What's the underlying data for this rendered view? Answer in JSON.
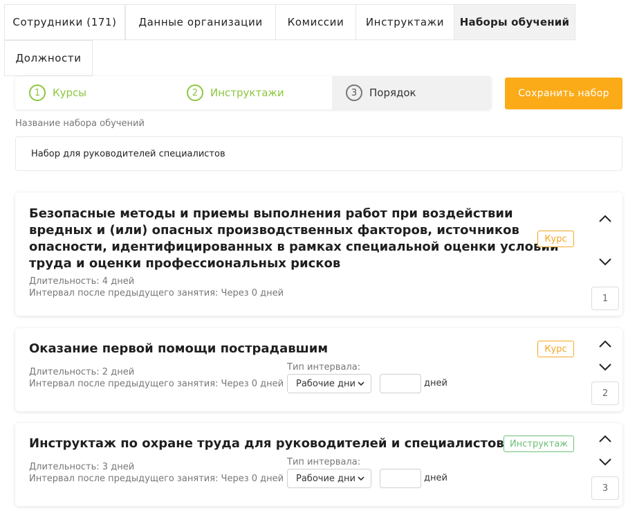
{
  "tabs": [
    {
      "label": "Сотрудники (171)",
      "active": false
    },
    {
      "label": "Данные организации",
      "active": false
    },
    {
      "label": "Комиссии",
      "active": false
    },
    {
      "label": "Инструктажи",
      "active": false
    },
    {
      "label": "Наборы обучений",
      "active": true
    },
    {
      "label": "Должности",
      "active": false
    }
  ],
  "stepper": [
    {
      "num": "1",
      "label": "Курсы",
      "state": "done"
    },
    {
      "num": "2",
      "label": "Инструктажи",
      "state": "done"
    },
    {
      "num": "3",
      "label": "Порядок",
      "state": "current"
    }
  ],
  "save_button": "Сохранить набор",
  "set_name": {
    "label": "Название набора обучений",
    "value": "Набор для руководителей специалистов"
  },
  "items": [
    {
      "title_lines": [
        "Безопасные методы и приемы выполнения работ при воздействии",
        "вредных и (или) опасных производственных факторов, источников",
        "опасности, идентифицированных в рамках специальной оценки условий",
        "труда и оценки профессиональных рисков"
      ],
      "badge": "Курс",
      "duration": "Длительность: 4 дней",
      "interval": "Интервал после предыдущего занятия: Через 0 дней",
      "order": "1"
    },
    {
      "title_lines": [
        "Оказание первой помощи пострадавшим"
      ],
      "badge": "Курс",
      "duration": "Длительность: 2 дней",
      "interval": "Интервал после предыдущего занятия: Через 0 дней",
      "interval_type_label": "Тип интервала:",
      "interval_type_value": "Рабочие дни",
      "interval_days_value": "",
      "days_unit": "дней",
      "order": "2"
    },
    {
      "title_lines": [
        "Инструктаж по охране труда для руководителей и специалистов"
      ],
      "badge": "Инструктаж",
      "duration": "Длительность: 3 дней",
      "interval": "Интервал после предыдущего занятия: Через 0 дней",
      "interval_type_label": "Тип интервала:",
      "interval_type_value": "Рабочие дни",
      "interval_days_value": "",
      "days_unit": "дней",
      "order": "3"
    }
  ],
  "colors": {
    "accent": "#fbab18",
    "done_step": "#8cc63f",
    "course_badge": "#f5a623",
    "briefing_badge": "#6cbf74"
  },
  "icons": {
    "up": "chevron-up-icon",
    "down": "chevron-down-icon",
    "select": "select-caret-icon"
  }
}
